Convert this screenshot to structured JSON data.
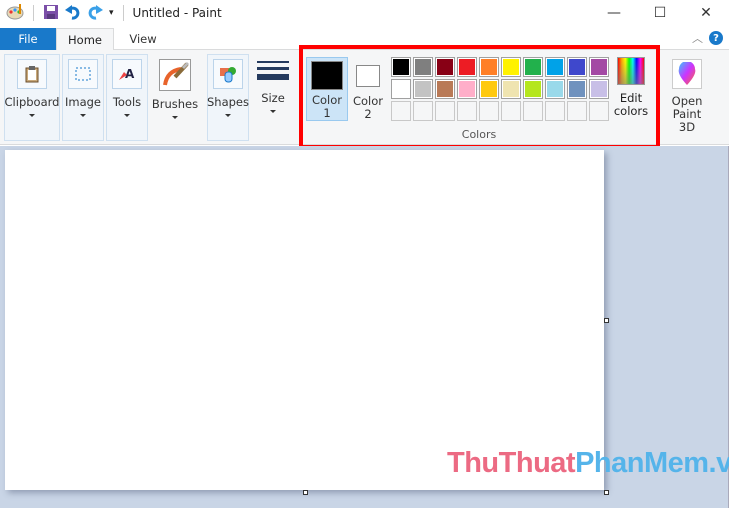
{
  "window": {
    "title": "Untitled - Paint",
    "minimize": "—",
    "maximize": "☐",
    "close": "✕"
  },
  "tabs": [
    {
      "label": "File"
    },
    {
      "label": "Home"
    },
    {
      "label": "View"
    }
  ],
  "help": "?",
  "ribbon": {
    "clipboard": "Clipboard",
    "image": "Image",
    "tools": "Tools",
    "brushes": "Brushes",
    "shapes": "Shapes",
    "size": "Size",
    "colors": {
      "group_label": "Colors",
      "color1": {
        "line1": "Color",
        "line2": "1",
        "value": "#000000"
      },
      "color2": {
        "line1": "Color",
        "line2": "2",
        "value": "#ffffff"
      },
      "palette": [
        "#000000",
        "#7f7f7f",
        "#880015",
        "#ed1c24",
        "#ff7f27",
        "#fff200",
        "#22b14c",
        "#00a2e8",
        "#3f48cc",
        "#a349a4",
        "#ffffff",
        "#c3c3c3",
        "#b97a57",
        "#ffaec9",
        "#ffc90e",
        "#efe4b0",
        "#b5e61d",
        "#99d9ea",
        "#7092be",
        "#c8bfe7"
      ],
      "empty_slots": 10,
      "edit_line1": "Edit",
      "edit_line2": "colors"
    },
    "paint3d_line1": "Open",
    "paint3d_line2": "Paint 3D"
  },
  "highlight_color": "#ff0000",
  "watermark": {
    "part1": "ThuThuat",
    "part2": "PhanMem.vn"
  }
}
